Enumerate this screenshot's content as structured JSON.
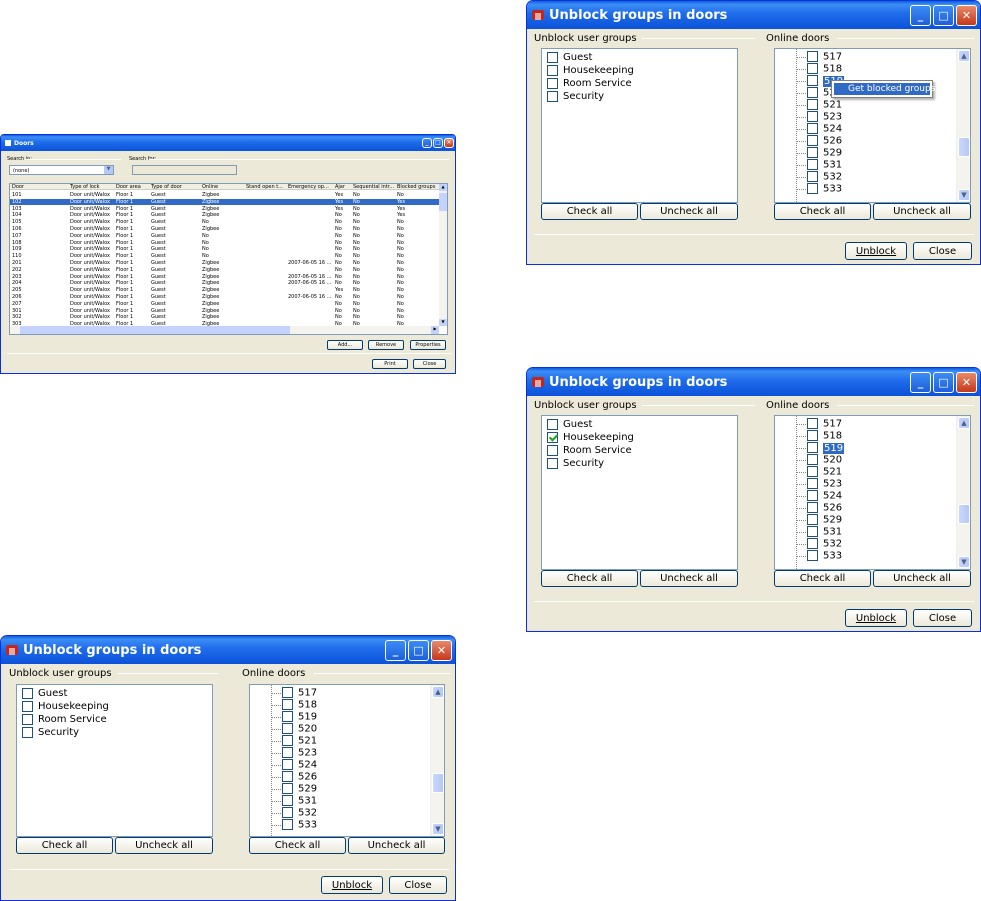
{
  "doors_window": {
    "title": "Doors",
    "search_in_label": "Search in:",
    "search_in_value": "(none)",
    "search_for_label": "Search for:",
    "columns": [
      "Door",
      "Type of lock",
      "Door area",
      "Type of door",
      "Online",
      "Stand open t...",
      "Emergency op...",
      "Ajar",
      "Sequential intr...",
      "Blocked groups"
    ],
    "rows": [
      [
        "101",
        "Door unit/Walox",
        "Floor 1",
        "Guest",
        "Zigbee",
        "",
        "",
        "Yes",
        "No",
        "No"
      ],
      [
        "102",
        "Door unit/Walox",
        "Floor 1",
        "Guest",
        "Zigbee",
        "",
        "",
        "Yes",
        "No",
        "Yes"
      ],
      [
        "103",
        "Door unit/Walox",
        "Floor 1",
        "Guest",
        "Zigbee",
        "",
        "",
        "Yes",
        "No",
        "Yes"
      ],
      [
        "104",
        "Door unit/Walox",
        "Floor 1",
        "Guest",
        "Zigbee",
        "",
        "",
        "No",
        "No",
        "Yes"
      ],
      [
        "105",
        "Door unit/Walox",
        "Floor 1",
        "Guest",
        "No",
        "",
        "",
        "No",
        "No",
        "No"
      ],
      [
        "106",
        "Door unit/Walox",
        "Floor 1",
        "Guest",
        "Zigbee",
        "",
        "",
        "No",
        "No",
        "No"
      ],
      [
        "107",
        "Door unit/Walox",
        "Floor 1",
        "Guest",
        "No",
        "",
        "",
        "No",
        "No",
        "No"
      ],
      [
        "108",
        "Door unit/Walox",
        "Floor 1",
        "Guest",
        "No",
        "",
        "",
        "No",
        "No",
        "No"
      ],
      [
        "109",
        "Door unit/Walox",
        "Floor 1",
        "Guest",
        "No",
        "",
        "",
        "No",
        "No",
        "No"
      ],
      [
        "110",
        "Door unit/Walox",
        "Floor 1",
        "Guest",
        "No",
        "",
        "",
        "No",
        "No",
        "No"
      ],
      [
        "201",
        "Door unit/Walox",
        "Floor 1",
        "Guest",
        "Zigbee",
        "",
        "2007-06-05 16 ...",
        "No",
        "No",
        "No"
      ],
      [
        "202",
        "Door unit/Walox",
        "Floor 1",
        "Guest",
        "Zigbee",
        "",
        "",
        "No",
        "No",
        "No"
      ],
      [
        "203",
        "Door unit/Walox",
        "Floor 1",
        "Guest",
        "Zigbee",
        "",
        "2007-06-05 16 ...",
        "No",
        "No",
        "No"
      ],
      [
        "204",
        "Door unit/Walox",
        "Floor 1",
        "Guest",
        "Zigbee",
        "",
        "2007-06-05 16 ...",
        "No",
        "No",
        "No"
      ],
      [
        "205",
        "Door unit/Walox",
        "Floor 1",
        "Guest",
        "Zigbee",
        "",
        "",
        "Yes",
        "No",
        "No"
      ],
      [
        "206",
        "Door unit/Walox",
        "Floor 1",
        "Guest",
        "Zigbee",
        "",
        "2007-06-05 16 ...",
        "No",
        "No",
        "No"
      ],
      [
        "207",
        "Door unit/Walox",
        "Floor 1",
        "Guest",
        "Zigbee",
        "",
        "",
        "No",
        "No",
        "No"
      ],
      [
        "301",
        "Door unit/Walox",
        "Floor 1",
        "Guest",
        "Zigbee",
        "",
        "",
        "No",
        "No",
        "No"
      ],
      [
        "302",
        "Door unit/Walox",
        "Floor 1",
        "Guest",
        "Zigbee",
        "",
        "",
        "No",
        "No",
        "No"
      ],
      [
        "303",
        "Door unit/Walox",
        "Floor 1",
        "Guest",
        "Zigbee",
        "",
        "",
        "No",
        "No",
        "No"
      ]
    ],
    "selected_row": "102",
    "buttons": {
      "add": "Add...",
      "remove": "Remove",
      "properties": "Properties",
      "print": "Print",
      "close": "Close"
    }
  },
  "unblock_dialog": {
    "title": "Unblock groups in doors",
    "groups_label": "Unblock user groups",
    "doors_label": "Online doors",
    "groups": [
      "Guest",
      "Housekeeping",
      "Room Service",
      "Security"
    ],
    "doors": [
      "517",
      "518",
      "519",
      "520",
      "521",
      "523",
      "524",
      "526",
      "529",
      "531",
      "532",
      "533"
    ],
    "check_all": "Check all",
    "uncheck_all": "Uncheck all",
    "unblock": "Unblock",
    "close": "Close",
    "context_menu_item": "Get blocked groups",
    "checked_group_in_third": "Housekeeping",
    "selected_door": "519"
  }
}
